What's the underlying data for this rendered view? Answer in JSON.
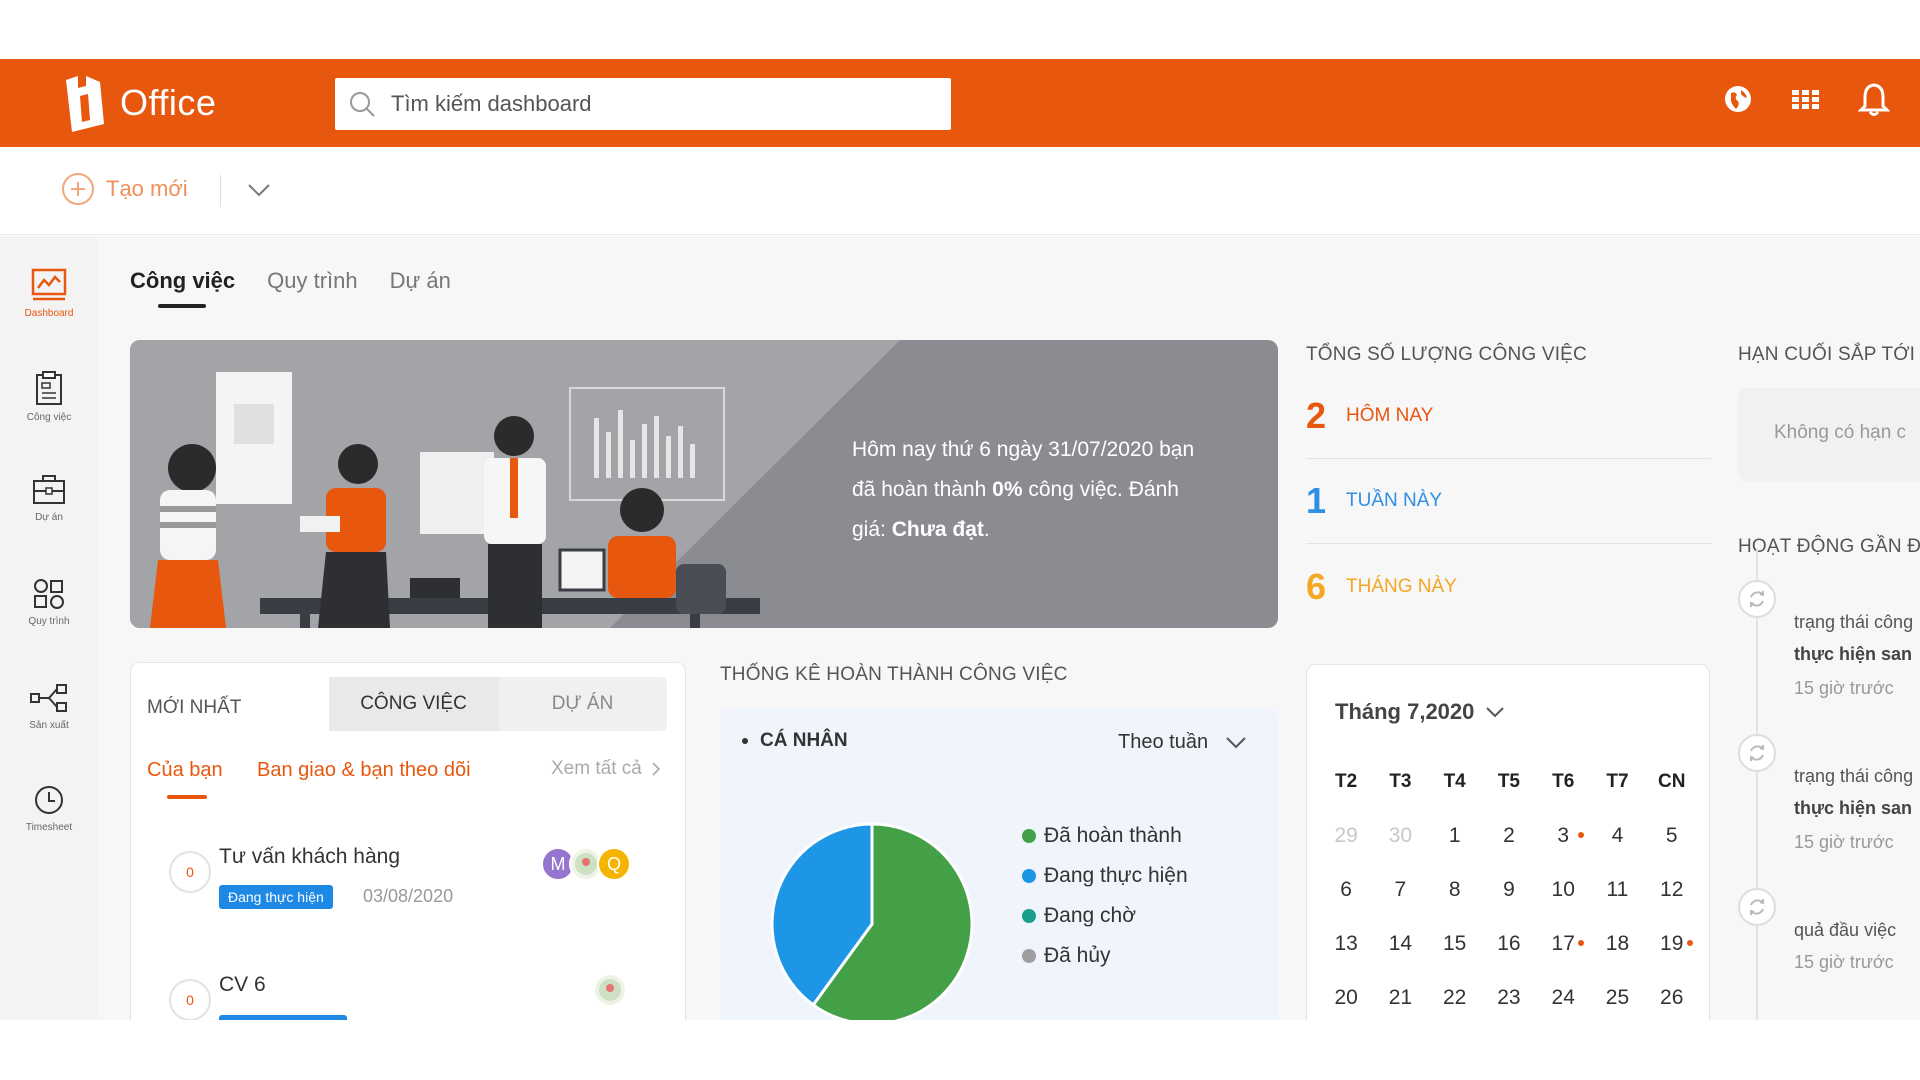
{
  "app": {
    "logo_text": "Office",
    "brand_color": "#e8570e"
  },
  "search": {
    "placeholder": "Tìm kiếm dashboard",
    "value": ""
  },
  "toolbar": {
    "create_label": "Tạo mới"
  },
  "sidebar": {
    "items": [
      {
        "label": "Dashboard",
        "icon": "dashboard-icon",
        "active": true
      },
      {
        "label": "Công việc",
        "icon": "clipboard-icon"
      },
      {
        "label": "Dự án",
        "icon": "briefcase-icon"
      },
      {
        "label": "Quy trình",
        "icon": "workflow-icon"
      },
      {
        "label": "Sản xuất",
        "icon": "share-nodes-icon"
      },
      {
        "label": "Timesheet",
        "icon": "clock-icon"
      }
    ]
  },
  "tabs": [
    {
      "label": "Công việc",
      "active": true
    },
    {
      "label": "Quy trình"
    },
    {
      "label": "Dự án"
    }
  ],
  "banner": {
    "line1": "Hôm nay thứ 6 ngày 31/07/2020 bạn",
    "line2_pre": "đã hoàn thành ",
    "line2_bold": "0%",
    "line2_post": " công việc. Đánh",
    "line3_pre": "giá: ",
    "line3_bold": "Chưa đạt",
    "line3_post": "."
  },
  "totals": {
    "title": "TỔNG SỐ LƯỢNG CÔNG VIỆC",
    "rows": [
      {
        "value": "2",
        "label": "HÔM NAY",
        "color": "#e8570e"
      },
      {
        "value": "1",
        "label": "TUẦN NÀY",
        "color": "#2f8fe5"
      },
      {
        "value": "6",
        "label": "THÁNG NÀY",
        "color": "#f5a623"
      }
    ]
  },
  "deadline": {
    "title": "HẠN CUỐI SẮP TỚI",
    "empty_text": "Không có hạn c"
  },
  "activity": {
    "title": "HOẠT ĐỘNG GẦN Đ",
    "items": [
      {
        "line1": "trạng thái công",
        "line2": "thực hiện san",
        "time": "15 giờ trước"
      },
      {
        "line1": "trạng thái công",
        "line2": "thực hiện san",
        "time": "15 giờ trước"
      },
      {
        "line1": "quả đầu việc",
        "line2": "",
        "time": "15 giờ trước"
      }
    ]
  },
  "latest": {
    "title": "MỚI NHẤT",
    "seg_work": "CÔNG VIỆC",
    "seg_project": "DỰ ÁN",
    "filter_yours": "Của bạn",
    "filter_assigned": "Ban giao & bạn theo dõi",
    "view_all": "Xem tất cả",
    "items": [
      {
        "count": "0",
        "title": "Tư vấn khách hàng",
        "status": "Đang thực hiện",
        "date": "03/08/2020",
        "avatars": [
          "M",
          "",
          "Q"
        ]
      },
      {
        "count": "0",
        "title": "CV 6"
      }
    ]
  },
  "completion": {
    "title": "THỐNG KÊ HOÀN THÀNH CÔNG VIỆC",
    "scope": "CÁ NHÂN",
    "period": "Theo tuần",
    "chart_data": {
      "type": "pie",
      "values": [
        60,
        40,
        0,
        0
      ],
      "labels": [
        "Đã hoàn thành",
        "Đang thực hiện",
        "Đang chờ",
        "Đã hủy"
      ],
      "colors": [
        "#43a047",
        "#1e96e6",
        "#1aa08a",
        "#9e9e9e"
      ]
    }
  },
  "calendar": {
    "month_label": "Tháng 7,2020",
    "weekdays": [
      "T2",
      "T3",
      "T4",
      "T5",
      "T6",
      "T7",
      "CN"
    ],
    "weeks": [
      [
        "29",
        "30",
        "1",
        "2",
        "3",
        "4",
        "5"
      ],
      [
        "6",
        "7",
        "8",
        "9",
        "10",
        "11",
        "12"
      ],
      [
        "13",
        "14",
        "15",
        "16",
        "17",
        "18",
        "19"
      ],
      [
        "20",
        "21",
        "22",
        "23",
        "24",
        "25",
        "26"
      ]
    ],
    "muted": [
      "29",
      "30"
    ],
    "event_days": [
      "3",
      "17",
      "19"
    ]
  }
}
